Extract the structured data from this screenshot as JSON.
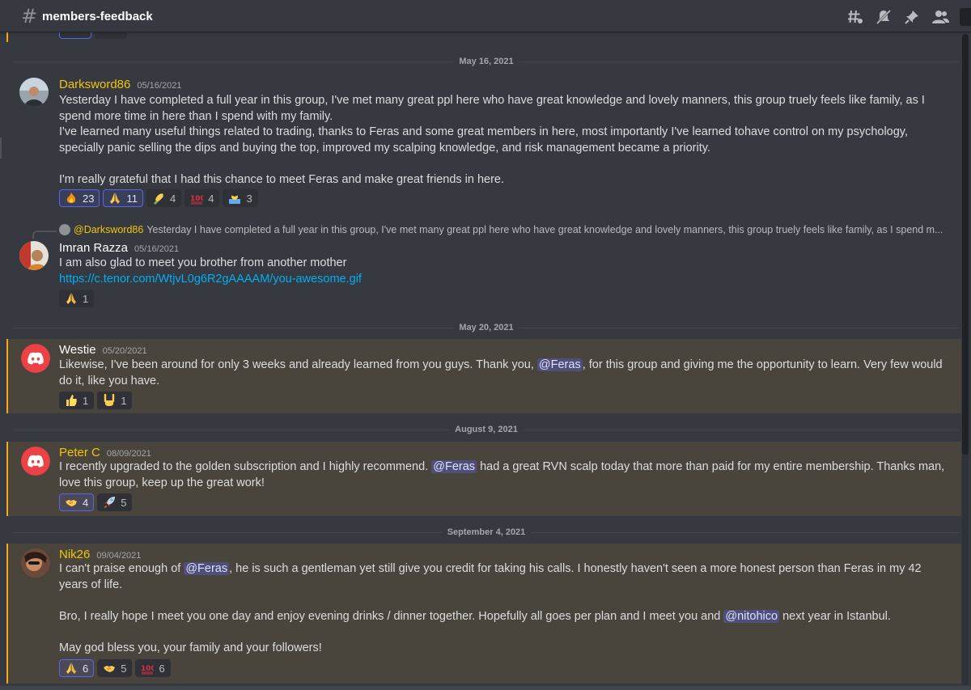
{
  "channel": {
    "name": "members-feedback"
  },
  "toolbar": {
    "icons": [
      "threads-icon",
      "mute-icon",
      "pin-icon",
      "members-icon"
    ]
  },
  "colors": {
    "background": "#36393f",
    "highlight": "#49443c",
    "highlight_border": "#faa61a",
    "author": "#f1c40f",
    "link": "#00aff4",
    "mention_bg": "#5865f2"
  },
  "dividers": [
    "May 16, 2021",
    "May 20, 2021",
    "August 9, 2021",
    "September 4, 2021"
  ],
  "messages": [
    {
      "author": "Darksword86",
      "timestamp": "05/16/2021",
      "paragraphs": [
        "Yesterday I have completed a full year in this group, I've met many great ppl here who have great knowledge and lovely manners, this group truely feels like family, as I spend more time in here than I spend with my family.",
        "I've learned many useful things related to trading, thanks to Feras and some great members in here, most importantly I've learned tohave control on my psychology, specially panic selling the dips and buying the top, improved my scalping knowledge, and risk management became a priority.",
        "",
        "I'm really grateful that I had this chance to meet Feras and make great friends in here."
      ],
      "reactions": [
        {
          "emoji": "fire-emoji",
          "count": "23",
          "me": true
        },
        {
          "emoji": "folded-hands-emoji",
          "count": "11",
          "me": true
        },
        {
          "emoji": "corn-emoji",
          "count": "4",
          "me": false
        },
        {
          "emoji": "hundred-emoji",
          "count": "4",
          "me": false
        },
        {
          "emoji": "student-emoji",
          "count": "3",
          "me": false
        }
      ]
    },
    {
      "author": "Imran Razza",
      "timestamp": "05/16/2021",
      "reply": {
        "author": "@Darksword86",
        "text": "Yesterday I have completed a full year in this group, I've met many great ppl here who have great knowledge and lovely manners, this group truely feels like family, as I spend m..."
      },
      "paragraphs": [
        "I am also glad to meet you brother from another mother"
      ],
      "link": "https://c.tenor.com/WtjvL0g6R2gAAAAM/you-awesome.gif",
      "reactions": [
        {
          "emoji": "folded-hands-emoji",
          "count": "1",
          "me": false
        }
      ]
    },
    {
      "author": "Westie",
      "timestamp": "05/20/2021",
      "text_before": "Likewise, I've been around for only 3 weeks and already learned from you guys. Thank you, ",
      "mention": "@Feras",
      "text_after": ", for this group and giving me the opportunity to learn. Very few would do it, like you have.",
      "reactions": [
        {
          "emoji": "thumbs-up-emoji",
          "count": "1",
          "me": false
        },
        {
          "emoji": "rock-on-emoji",
          "count": "1",
          "me": false
        }
      ]
    },
    {
      "author": "Peter C",
      "timestamp": "08/09/2021",
      "text_before": "I recently upgraded to the golden subscription and I highly recommend. ",
      "mention": "@Feras",
      "text_after": " had a great RVN scalp today that more than paid for my entire membership. Thanks man, love this group, keep up the great work!",
      "reactions": [
        {
          "emoji": "handshake-emoji",
          "count": "4",
          "me": true
        },
        {
          "emoji": "rocket-emoji",
          "count": "5",
          "me": false
        }
      ]
    },
    {
      "author": "Nik26",
      "timestamp": "09/04/2021",
      "p1_before": "I can't praise enough of ",
      "p1_mention": "@Feras",
      "p1_after": ", he is such a gentleman yet still give you credit for taking his calls. I honestly haven't seen a more honest person than Feras in my 42 years of life.",
      "p2_before": "Bro, I really hope I meet you one day and enjoy evening drinks / dinner together. Hopefully all goes per plan and I meet you and ",
      "p2_mention": "@nitohico",
      "p2_after": " next year in Istanbul.",
      "p3": "May god bless you, your family and your followers!",
      "reactions": [
        {
          "emoji": "folded-hands-emoji",
          "count": "6",
          "me": true
        },
        {
          "emoji": "handshake-emoji",
          "count": "5",
          "me": false
        },
        {
          "emoji": "hundred-emoji",
          "count": "6",
          "me": false
        }
      ]
    }
  ]
}
